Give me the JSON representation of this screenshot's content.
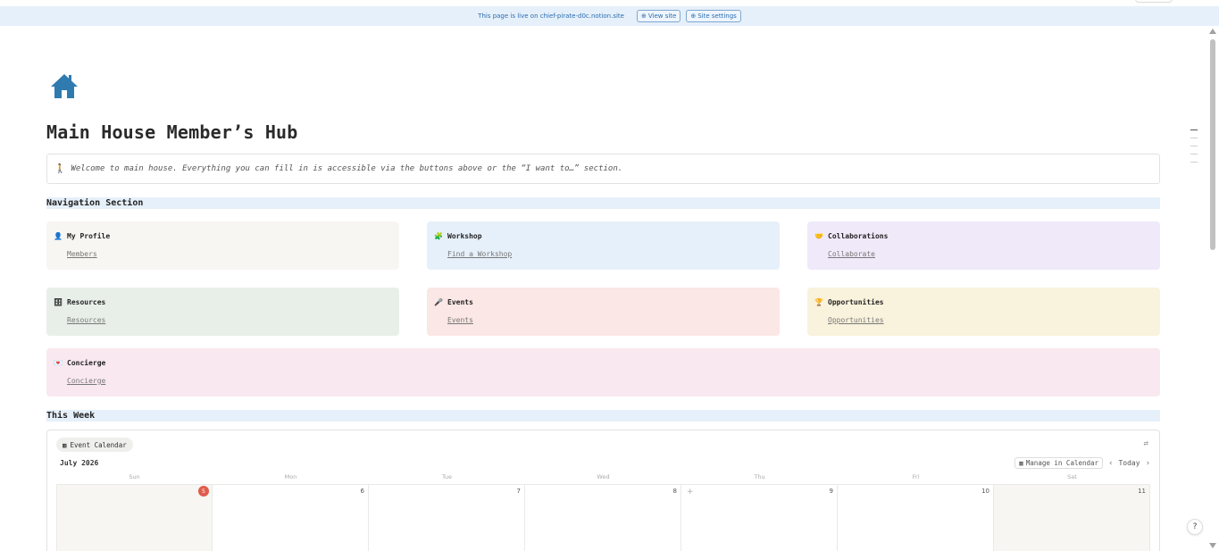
{
  "banner": {
    "message": "This page is live on chief-pirate-d0c.notion.site",
    "view_site": "View site",
    "site_settings": "Site settings"
  },
  "page": {
    "title": "Main House Member’s Hub",
    "icon": "house-icon",
    "callout": "Welcome to main house. Everything you can fill in is accessible via the buttons above or the “I want to…”  section."
  },
  "navigation": {
    "heading": "Navigation Section",
    "cards": [
      {
        "icon": "person-icon",
        "glyph": "👤",
        "title": "My Profile",
        "link": "Members"
      },
      {
        "icon": "puzzle-icon",
        "glyph": "🧩",
        "title": "Workshop",
        "link": "Find a Workshop"
      },
      {
        "icon": "handshake-icon",
        "glyph": "🤝",
        "title": "Collaborations",
        "link": "Collaborate"
      },
      {
        "icon": "cabinet-icon",
        "glyph": "🗄",
        "title": "Resources",
        "link": "Resources"
      },
      {
        "icon": "microphone-icon",
        "glyph": "🎤",
        "title": "Events",
        "link": "Events"
      },
      {
        "icon": "trophy-icon",
        "glyph": "🏆",
        "title": "Opportunities",
        "link": "Opportunities"
      },
      {
        "icon": "love-letter-icon",
        "glyph": "💌",
        "title": "Concierge",
        "link": "Concierge"
      }
    ]
  },
  "this_week": {
    "heading": "This Week",
    "calendar_tab": "Event Calendar",
    "month": "July 2026",
    "manage": "Manage in Calendar",
    "today": "Today",
    "weekdays": [
      "Sun",
      "Mon",
      "Tue",
      "Wed",
      "Thu",
      "Fri",
      "Sat"
    ],
    "days": [
      "5",
      "6",
      "7",
      "8",
      "9",
      "10",
      "11"
    ]
  },
  "colors": {
    "accent_blue": "#2b6cb0",
    "today_red": "#e05b4b",
    "house_icon": "#2f7bb0"
  }
}
